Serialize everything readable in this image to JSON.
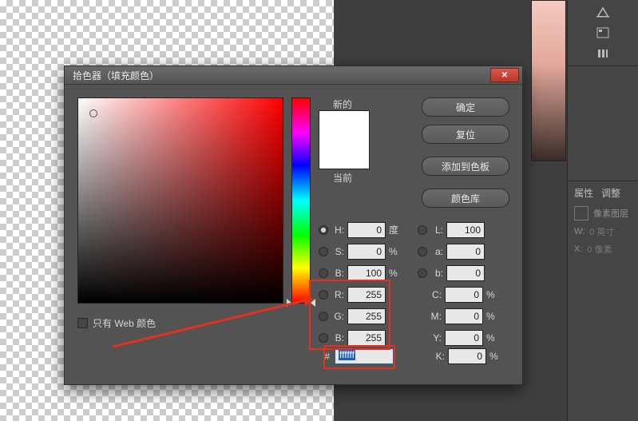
{
  "sidebar": {
    "tabs": [
      "属性",
      "调整"
    ],
    "subtitle": "像素图层",
    "w_label": "W:",
    "w_value": "0 英寸",
    "x_label": "X:",
    "x_value": "0 像素"
  },
  "dialog": {
    "title": "拾色器（填充颜色）",
    "new_label": "新的",
    "current_label": "当前",
    "buttons": {
      "ok": "确定",
      "reset": "复位",
      "add_swatch": "添加到色板",
      "color_lib": "颜色库"
    },
    "web_only_label": "只有 Web 颜色",
    "hex_label": "#",
    "hex_value": "ffffff",
    "fields": {
      "H": {
        "label": "H:",
        "value": "0",
        "unit": "度"
      },
      "S": {
        "label": "S:",
        "value": "0",
        "unit": "%"
      },
      "Bv": {
        "label": "B:",
        "value": "100",
        "unit": "%"
      },
      "R": {
        "label": "R:",
        "value": "255",
        "unit": ""
      },
      "G": {
        "label": "G:",
        "value": "255",
        "unit": ""
      },
      "Bc": {
        "label": "B:",
        "value": "255",
        "unit": ""
      },
      "L": {
        "label": "L:",
        "value": "100",
        "unit": ""
      },
      "a": {
        "label": "a:",
        "value": "0",
        "unit": ""
      },
      "b": {
        "label": "b:",
        "value": "0",
        "unit": ""
      },
      "C": {
        "label": "C:",
        "value": "0",
        "unit": "%"
      },
      "M": {
        "label": "M:",
        "value": "0",
        "unit": "%"
      },
      "Y": {
        "label": "Y:",
        "value": "0",
        "unit": "%"
      },
      "K": {
        "label": "K:",
        "value": "0",
        "unit": "%"
      }
    }
  }
}
